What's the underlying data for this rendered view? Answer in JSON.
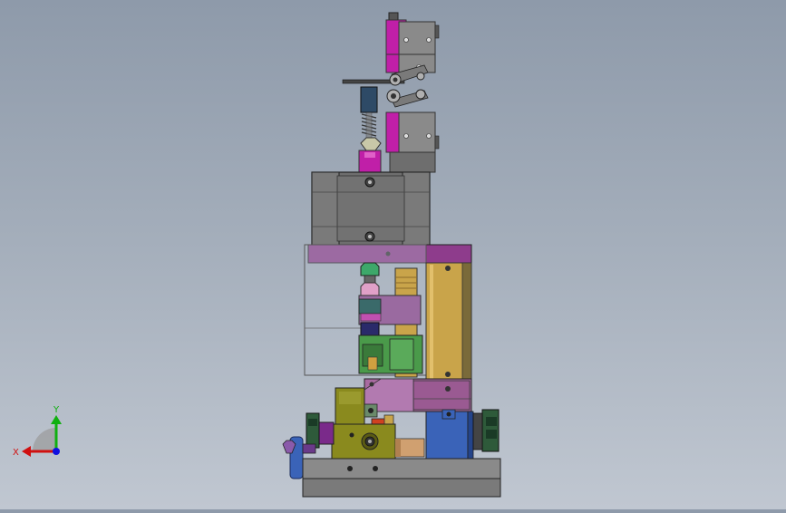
{
  "viewport": {
    "background_top": "#8e9aaa",
    "background_bottom": "#c0c7d1"
  },
  "triad": {
    "x_label": "X",
    "y_label": "Y",
    "x_color": "#d01010",
    "y_color": "#10b010",
    "z_color": "#1010e0"
  },
  "model": {
    "part_colors": {
      "magenta": "#c01fa8",
      "gray": "#6e6e6e",
      "purple": "#8e3c8c",
      "gold": "#c9a44a",
      "olive": "#8a8a1e",
      "blue": "#3a63b8",
      "green_dark": "#2e5a3a",
      "orange": "#d08a3c"
    }
  }
}
